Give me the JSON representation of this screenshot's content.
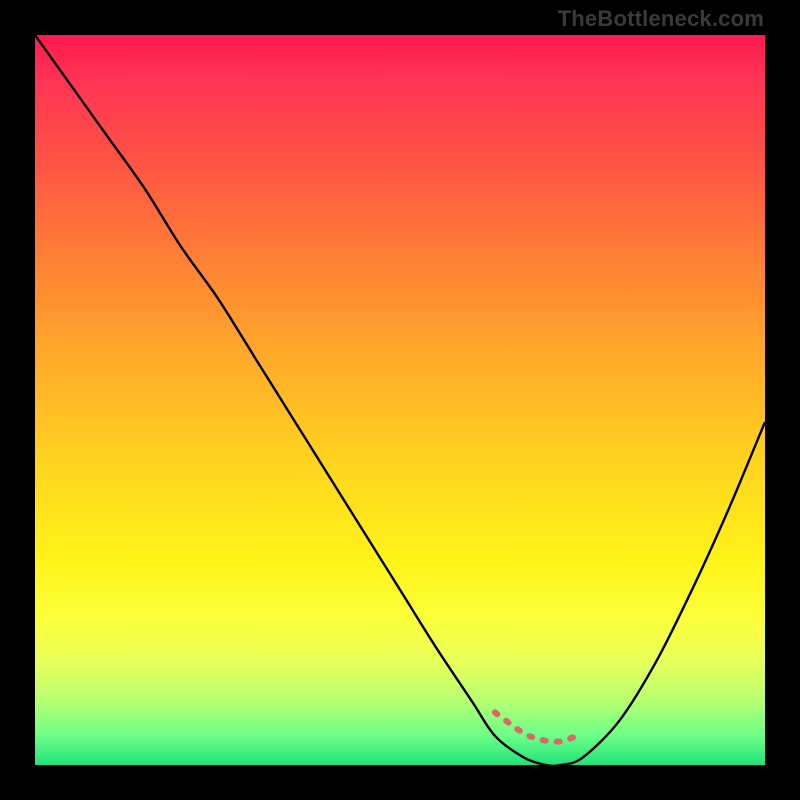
{
  "attribution": "TheBottleneck.com",
  "chart_data": {
    "type": "line",
    "title": "",
    "xlabel": "",
    "ylabel": "",
    "xlim": [
      0,
      100
    ],
    "ylim": [
      0,
      100
    ],
    "series": [
      {
        "name": "bottleneck-curve",
        "x": [
          0,
          5,
          10,
          15,
          20,
          25,
          30,
          35,
          40,
          45,
          50,
          55,
          60,
          63,
          67,
          70,
          72,
          75,
          80,
          85,
          90,
          95,
          100
        ],
        "values": [
          100,
          93,
          86,
          79,
          71,
          64,
          56,
          48,
          40,
          32,
          24,
          16,
          8.5,
          4,
          1,
          0,
          0,
          1,
          6,
          14,
          24,
          35,
          47
        ]
      }
    ],
    "annotations": {
      "optimal_band_x": [
        63,
        75
      ],
      "note": "dotted salmon segment near curve minimum"
    },
    "colors": {
      "curve": "#000000",
      "dotted_segment": "#d86a63",
      "gradient_top": "#ff1a4d",
      "gradient_bottom": "#21e27a"
    }
  }
}
